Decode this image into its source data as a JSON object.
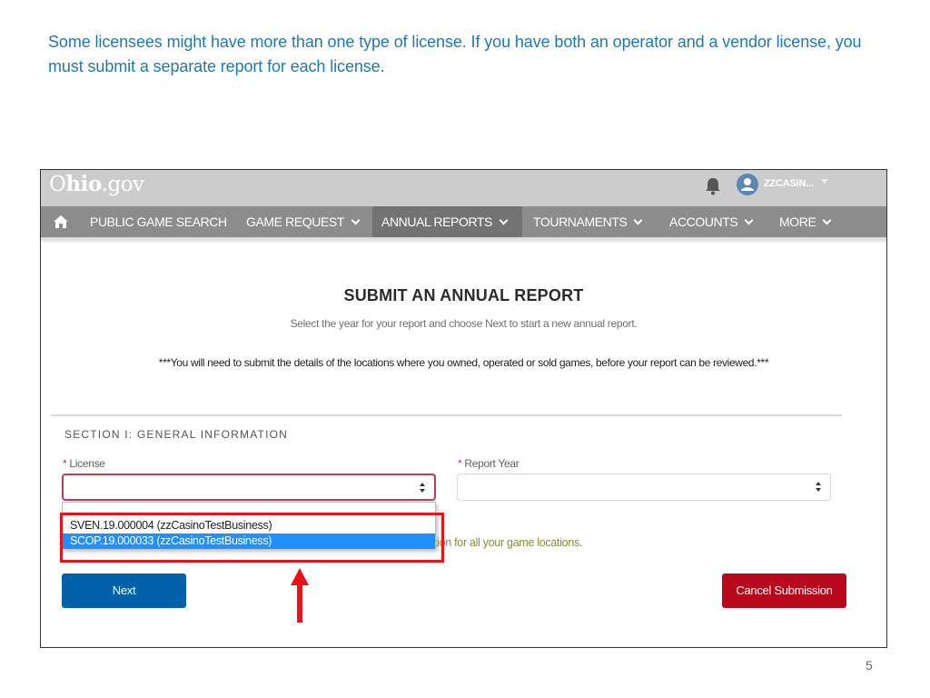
{
  "slide": {
    "caption": "Some licensees might have more than one type of license. If you have both an operator and a vendor license, you must submit a separate report for each license.",
    "page_number": "5"
  },
  "app": {
    "logo_bold": "hio",
    "logo_prefix": "O",
    "logo_suffix": ".gov",
    "user_name": "ZZCASIN...",
    "icons": {
      "notifications": "bell-icon",
      "user": "user-avatar-icon",
      "home": "home-icon",
      "user_menu": "caret-down-icon"
    }
  },
  "nav": {
    "items": [
      {
        "label": "PUBLIC GAME SEARCH",
        "has_dropdown": false,
        "active": false
      },
      {
        "label": "GAME REQUEST",
        "has_dropdown": true,
        "active": false
      },
      {
        "label": "ANNUAL REPORTS",
        "has_dropdown": true,
        "active": true
      },
      {
        "label": "TOURNAMENTS",
        "has_dropdown": true,
        "active": false
      },
      {
        "label": "ACCOUNTS",
        "has_dropdown": true,
        "active": false
      },
      {
        "label": "MORE",
        "has_dropdown": true,
        "active": false
      }
    ]
  },
  "main": {
    "title": "SUBMIT AN ANNUAL REPORT",
    "subtitle": "Select the year for your report and choose Next to start a new annual report.",
    "notice": "***You will need to submit the details of the locations where you owned, operated or sold games, before your report can be reviewed.***",
    "section_title": "SECTION I: GENERAL INFORMATION",
    "license_field": {
      "required_marker": "*",
      "label": "License",
      "value": "",
      "options": [
        {
          "label": "SVEN.19.000004 (zzCasinoTestBusiness)",
          "selected": false
        },
        {
          "label": "SCOP.19.000033 (zzCasinoTestBusiness)",
          "selected": true
        }
      ]
    },
    "report_year_field": {
      "required_marker": "*",
      "label": "Report Year",
      "value": ""
    },
    "hint_text": "tion for all your game locations.",
    "next_label": "Next",
    "cancel_label": "Cancel Submission"
  },
  "colors": {
    "caption": "#1f78b4",
    "next_button": "#0061a8",
    "cancel_button": "#b8081c",
    "selected_option": "#1e90ff",
    "annotation": "#e8121b",
    "error_border": "#c23952"
  }
}
